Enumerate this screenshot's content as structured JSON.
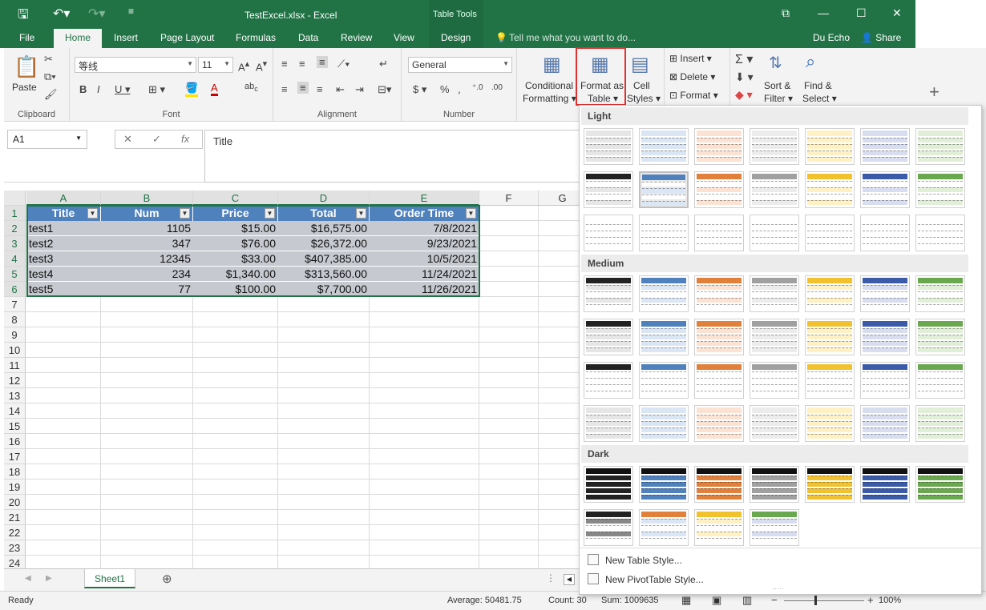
{
  "window": {
    "title": "TestExcel.xlsx - Excel",
    "context_tab": "Table Tools",
    "user": "Du Echo",
    "share": "Share"
  },
  "tabs": [
    "File",
    "Home",
    "Insert",
    "Page Layout",
    "Formulas",
    "Data",
    "Review",
    "View",
    "Design"
  ],
  "tell_me": "Tell me what you want to do...",
  "ribbon": {
    "clipboard": {
      "label": "Clipboard",
      "paste": "Paste"
    },
    "font": {
      "label": "Font",
      "name": "等线",
      "size": "11"
    },
    "alignment": {
      "label": "Alignment"
    },
    "number": {
      "label": "Number",
      "format": "General"
    },
    "styles": {
      "conditional": "Conditional",
      "formatting": "Formatting",
      "format_as": "Format as",
      "table": "Table",
      "cell": "Cell",
      "styles": "Styles"
    },
    "cells": {
      "insert": "Insert",
      "delete": "Delete",
      "format": "Format"
    },
    "editing": {
      "sort1": "Sort &",
      "sort2": "Filter",
      "find1": "Find &",
      "find2": "Select"
    }
  },
  "formula": {
    "name_box": "A1",
    "value": "Title",
    "fx": "fx"
  },
  "columns": [
    "A",
    "B",
    "C",
    "D",
    "E",
    "F",
    "G"
  ],
  "rows": [
    "1",
    "2",
    "3",
    "4",
    "5",
    "6",
    "7",
    "8",
    "9",
    "10",
    "11",
    "12",
    "13",
    "14",
    "15",
    "16",
    "17",
    "18",
    "19",
    "20",
    "21",
    "22",
    "23",
    "24"
  ],
  "table": {
    "headers": [
      "Title",
      "Num",
      "Price",
      "Total",
      "Order Time"
    ],
    "data": [
      [
        "test1",
        "1105",
        "$15.00",
        "$16,575.00",
        "7/8/2021"
      ],
      [
        "test2",
        "347",
        "$76.00",
        "$26,372.00",
        "9/23/2021"
      ],
      [
        "test3",
        "12345",
        "$33.00",
        "$407,385.00",
        "10/5/2021"
      ],
      [
        "test4",
        "234",
        "$1,340.00",
        "$313,560.00",
        "11/24/2021"
      ],
      [
        "test5",
        "77",
        "$100.00",
        "$7,700.00",
        "11/26/2021"
      ]
    ]
  },
  "sheet": "Sheet1",
  "status": {
    "ready": "Ready",
    "average": "Average: 50481.75",
    "count": "Count: 30",
    "sum": "Sum: 1009635",
    "zoom": "100%"
  },
  "gallery": {
    "sections": [
      "Light",
      "Medium",
      "Dark"
    ],
    "colors": [
      "#222222",
      "#4f81bd",
      "#e0803a",
      "#a0a0a0",
      "#f2c12e",
      "#3b5ba8",
      "#6aa84f"
    ],
    "tints": [
      "#e6e6e6",
      "#dbe6f4",
      "#fbe2d2",
      "#ececec",
      "#fff1c4",
      "#d8def0",
      "#e1efd8"
    ],
    "new_table_style": "New Table Style...",
    "new_pivot_style": "New PivotTable Style..."
  }
}
